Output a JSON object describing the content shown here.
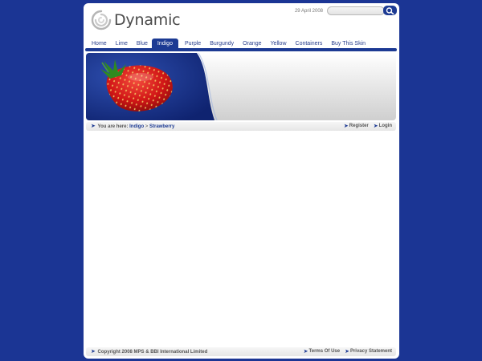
{
  "header": {
    "logo_text": "Dynamic",
    "date": "29 April 2008",
    "search": {
      "placeholder": ""
    }
  },
  "nav": {
    "items": [
      {
        "label": "Home"
      },
      {
        "label": "Lime"
      },
      {
        "label": "Blue"
      },
      {
        "label": "Indigo",
        "active": true
      },
      {
        "label": "Purple"
      },
      {
        "label": "Burgundy"
      },
      {
        "label": "Orange"
      },
      {
        "label": "Yellow"
      },
      {
        "label": "Containers"
      },
      {
        "label": "Buy This Skin"
      }
    ]
  },
  "breadcrumb": {
    "prefix": "You are here:",
    "level1": "Indigo",
    "separator": ">",
    "level2": "Strawberry"
  },
  "user_links": {
    "register": "Register",
    "login": "Login"
  },
  "footer": {
    "copyright": "Copyright 2008 MPS & BBI International Limited",
    "terms": "Terms Of Use",
    "privacy": "Privacy Statement"
  },
  "colors": {
    "background": "#1b3594",
    "accent": "#1c3a93",
    "strawberry": "#d81a1a"
  }
}
